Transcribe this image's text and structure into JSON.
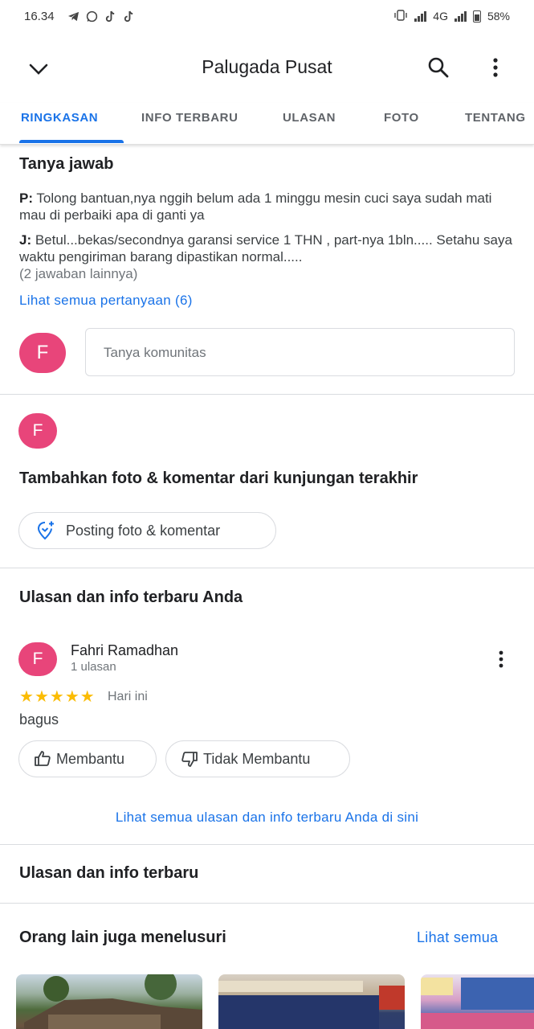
{
  "status_bar": {
    "time": "16.34",
    "network": "4G",
    "battery": "58%"
  },
  "app_bar": {
    "title": "Palugada Pusat"
  },
  "tabs": [
    {
      "label": "RINGKASAN",
      "active": true
    },
    {
      "label": "INFO TERBARU",
      "active": false
    },
    {
      "label": "ULASAN",
      "active": false
    },
    {
      "label": "FOTO",
      "active": false
    },
    {
      "label": "TENTANG",
      "active": false
    }
  ],
  "qa": {
    "title": "Tanya jawab",
    "question_prefix": "P:",
    "question_text": " Tolong bantuan,nya nggih belum ada 1 minggu mesin cuci saya sudah mati mau di perbaiki apa di ganti ya",
    "answer_prefix": "J:",
    "answer_text": " Betul...bekas/secondnya garansi service 1 THN , part-nya 1bln..... Setahu saya waktu pengiriman barang dipastikan normal.....",
    "more_answers": "(2 jawaban lainnya)",
    "see_all_link": "Lihat semua pertanyaan (6)",
    "avatar_initial": "F",
    "ask_placeholder": "Tanya komunitas"
  },
  "add_photo": {
    "avatar_initial": "F",
    "title": "Tambahkan foto & komentar dari kunjungan terakhir",
    "button_label": "Posting foto & komentar"
  },
  "your_reviews": {
    "title": "Ulasan dan info terbaru Anda",
    "reviewer_initial": "F",
    "reviewer_name": "Fahri Ramadhan",
    "reviewer_meta": "1 ulasan",
    "rating": 5,
    "date": "Hari ini",
    "text": "bagus",
    "helpful_label": "Membantu",
    "not_helpful_label": "Tidak Membantu",
    "see_all_link": "Lihat semua ulasan dan info terbaru Anda di sini"
  },
  "latest_reviews": {
    "title": "Ulasan dan info terbaru"
  },
  "also_searched": {
    "title": "Orang lain juga menelusuri",
    "see_all": "Lihat semua"
  },
  "colors": {
    "accent": "#1a73e8",
    "avatar": "#e8457a",
    "star": "#fbbc04"
  }
}
